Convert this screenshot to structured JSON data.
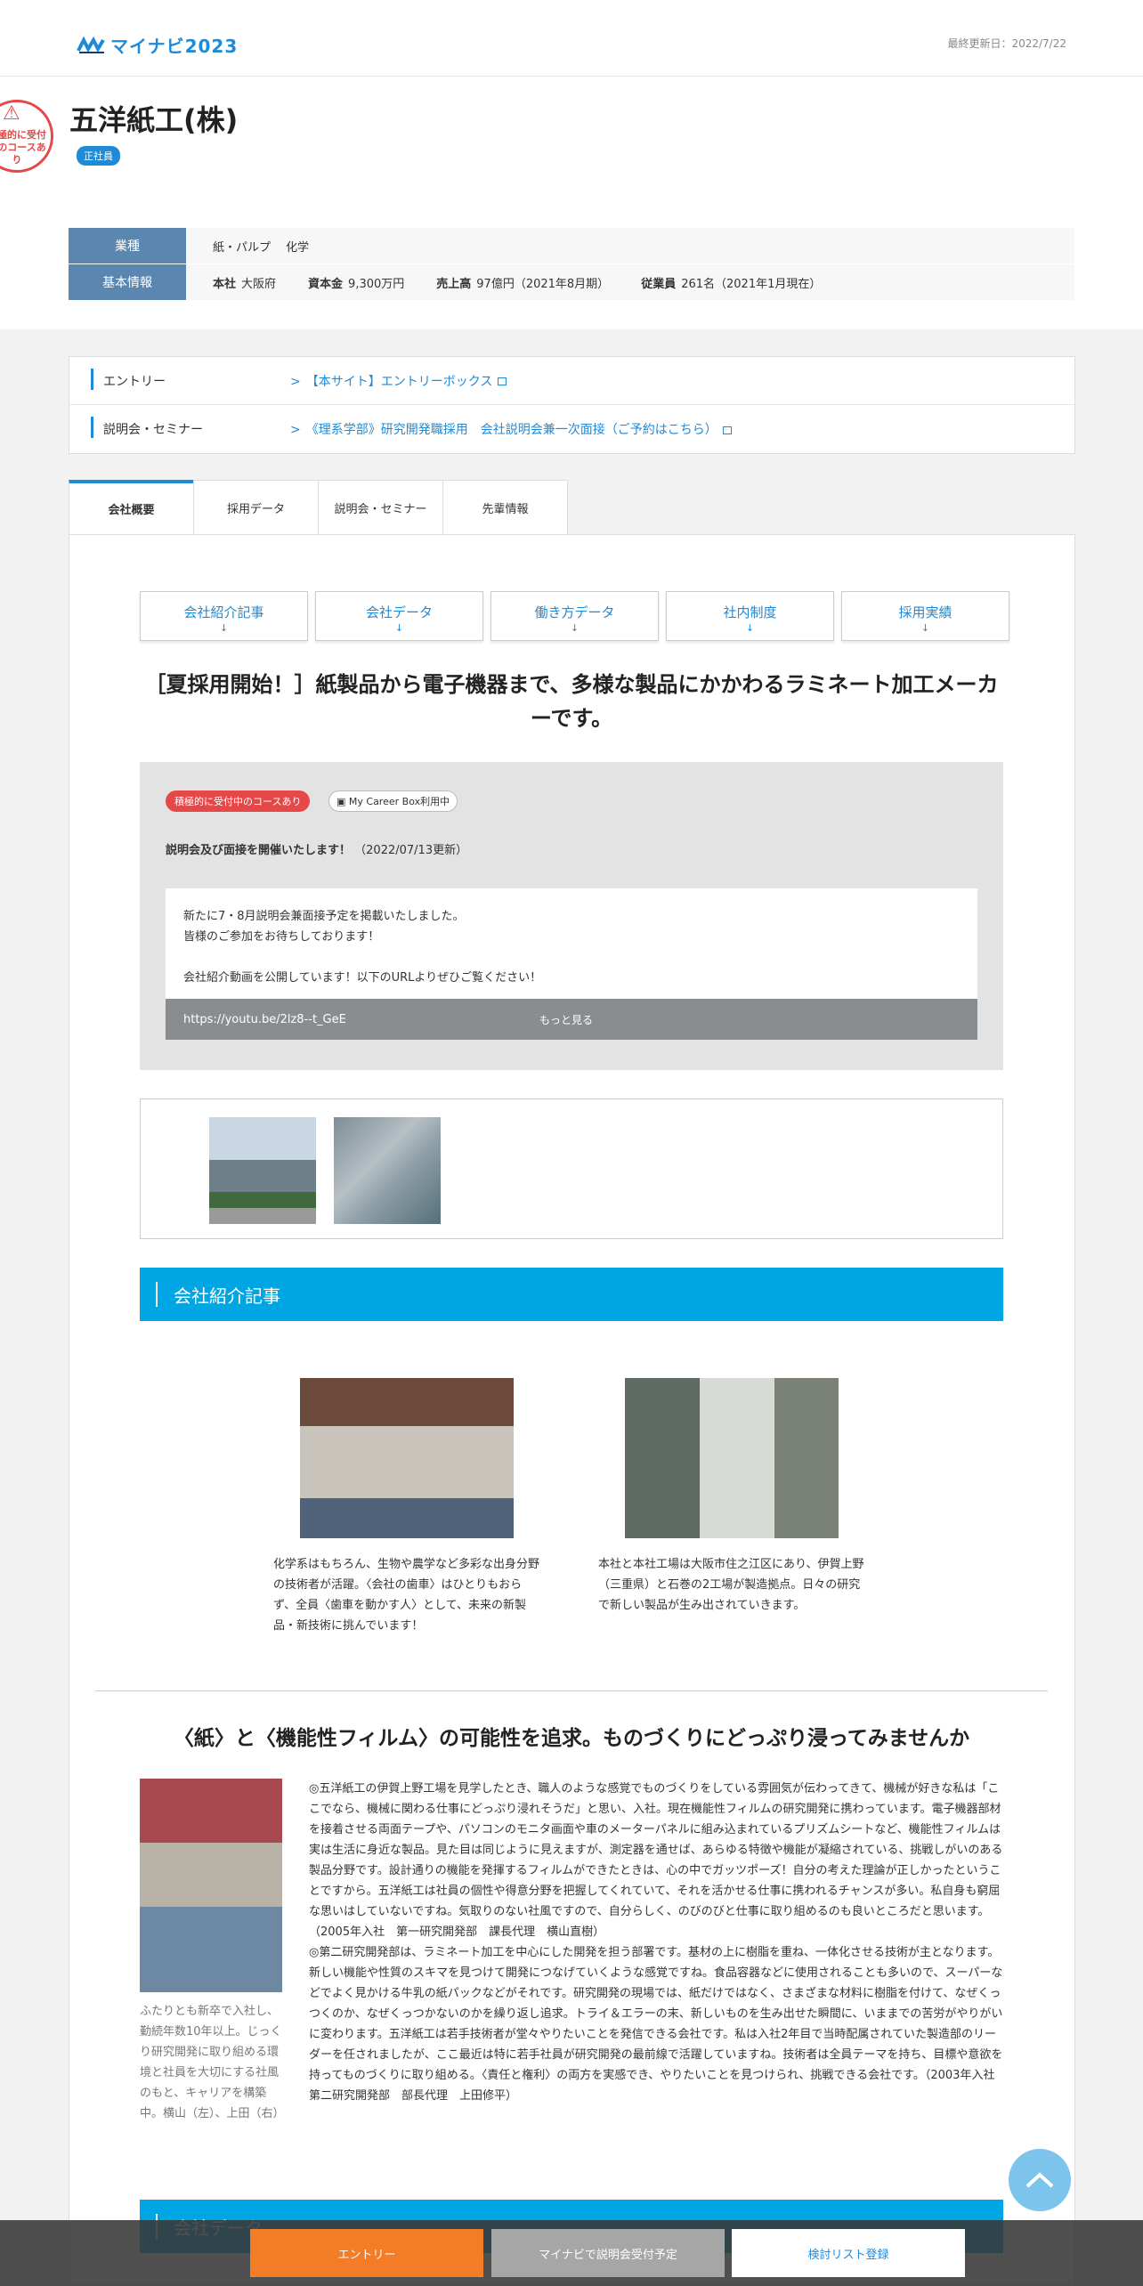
{
  "header": {
    "brand": "マイナビ2023",
    "updated": "最終更新日：2022/7/22"
  },
  "company": {
    "stamp": "積極的に受付中のコースあり",
    "name": "五洋紙工(株)",
    "badge": "正社員",
    "industry_label": "業種",
    "industry": "紙・パルプ　 化学",
    "basic_label": "基本情報",
    "honsha_k": "本社",
    "honsha": "大阪府",
    "capital_k": "資本金",
    "capital": "9,300万円",
    "sales_k": "売上高",
    "sales": "97億円（2021年8月期）",
    "emp_k": "従業員",
    "emp": "261名（2021年1月現在）"
  },
  "links": [
    {
      "label": "エントリー",
      "text": "【本サイト】エントリーボックス"
    },
    {
      "label": "説明会・セミナー",
      "text": "《理系学部》研究開発職採用　会社説明会兼一次面接（ご予約はこちら）"
    }
  ],
  "tabs": [
    "会社概要",
    "採用データ",
    "説明会・セミナー",
    "先輩情報"
  ],
  "subnav": [
    "会社紹介記事",
    "会社データ",
    "働き方データ",
    "社内制度",
    "採用実績"
  ],
  "subnav_arrow": "↓",
  "headline": "［夏採用開始！］紙製品から電子機器まで、多様な製品にかかわるラミネート加工メーカーです。",
  "news": {
    "tag_active": "積極的に受付中のコースあり",
    "tag_mcb": "My Career Box利用中",
    "title": "説明会及び面接を開催いたします！",
    "date": "（2022/07/13更新）",
    "line1": "新たに7・8月説明会兼面接予定を掲載いたしました。",
    "line2": "皆様のご参加をお待ちしております！",
    "line3": "会社紹介動画を公開しています！以下のURLよりぜひご覧ください！",
    "url": "https://youtu.be/2lz8--t_GeE",
    "more": "もっと見る"
  },
  "section1": "会社紹介記事",
  "articles": [
    "化学系はもちろん、生物や農学など多彩な出身分野の技術者が活躍。〈会社の歯車〉はひとりもおらず、全員〈歯車を動かす人〉として、未来の新製品・新技術に挑んでいます！",
    "本社と本社工場は大阪市住之江区にあり、伊賀上野（三重県）と石巻の2工場が製造拠点。日々の研究で新しい製品が生み出されていきます。"
  ],
  "interview": {
    "heading": "〈紙〉と〈機能性フィルム〉の可能性を追求。ものづくりにどっぷり浸ってみませんか",
    "caption": "ふたりとも新卒で入社し、勤続年数10年以上。じっくり研究開発に取り組める環境と社員を大切にする社風のもと、キャリアを構築中。横山（左）、上田（右）",
    "p1": "◎五洋紙工の伊賀上野工場を見学したとき、職人のような感覚でものづくりをしている雰囲気が伝わってきて、機械が好きな私は「ここでなら、機械に関わる仕事にどっぷり浸れそうだ」と思い、入社。現在機能性フィルムの研究開発に携わっています。電子機器部材を接着させる両面テープや、パソコンのモニタ画面や車のメーターパネルに組み込まれているプリズムシートなど、機能性フィルムは実は生活に身近な製品。見た目は同じように見えますが、測定器を通せば、あらゆる特徴や機能が凝縮されている、挑戦しがいのある製品分野です。設計通りの機能を発揮するフィルムができたときは、心の中でガッツポーズ！自分の考えた理論が正しかったということですから。五洋紙工は社員の個性や得意分野を把握してくれていて、それを活かせる仕事に携われるチャンスが多い。私自身も窮屈な思いはしていないですね。気取りのない社風ですので、自分らしく、のびのびと仕事に取り組めるのも良いところだと思います。（2005年入社　第一研究開発部　課長代理　横山直樹）",
    "p2": "◎第二研究開発部は、ラミネート加工を中心にした開発を担う部署です。基材の上に樹脂を重ね、一体化させる技術が主となります。新しい機能や性質のスキマを見つけて開発につなげていくような感覚ですね。食品容器などに使用されることも多いので、スーパーなどでよく見かける牛乳の紙パックなどがそれです。研究開発の現場では、紙だけではなく、さまざまな材料に樹脂を付けて、なぜくっつくのか、なぜくっつかないのかを繰り返し追求。トライ＆エラーの末、新しいものを生み出せた瞬間に、いままでの苦労がやりがいに変わります。五洋紙工は若手技術者が堂々やりたいことを発信できる会社です。私は入社2年目で当時配属されていた製造部のリーダーを任されましたが、ここ最近は特に若手社員が研究開発の最前線で活躍していますね。技術者は全員テーマを持ち、目標や意欲を持ってものづくりに取り組める。〈責任と権利〉の両方を実感でき、やりたいことを見つけられ、挑戦できる会社です。（2003年入社　第二研究開発部　部長代理　上田修平）"
  },
  "section2": "会社データ",
  "bottom": {
    "entry": "エントリー",
    "seminar": "マイナビで説明会受付予定",
    "fav": "検討リスト登録"
  },
  "colors": {
    "accent": "#1f8ad6",
    "section": "#00a6e3",
    "entry": "#f37d27",
    "stamp": "#e54848"
  },
  "icons": {
    "logo": "mynavi-logo-icon",
    "external": "external-link-icon",
    "totop": "chevron-up-icon"
  }
}
